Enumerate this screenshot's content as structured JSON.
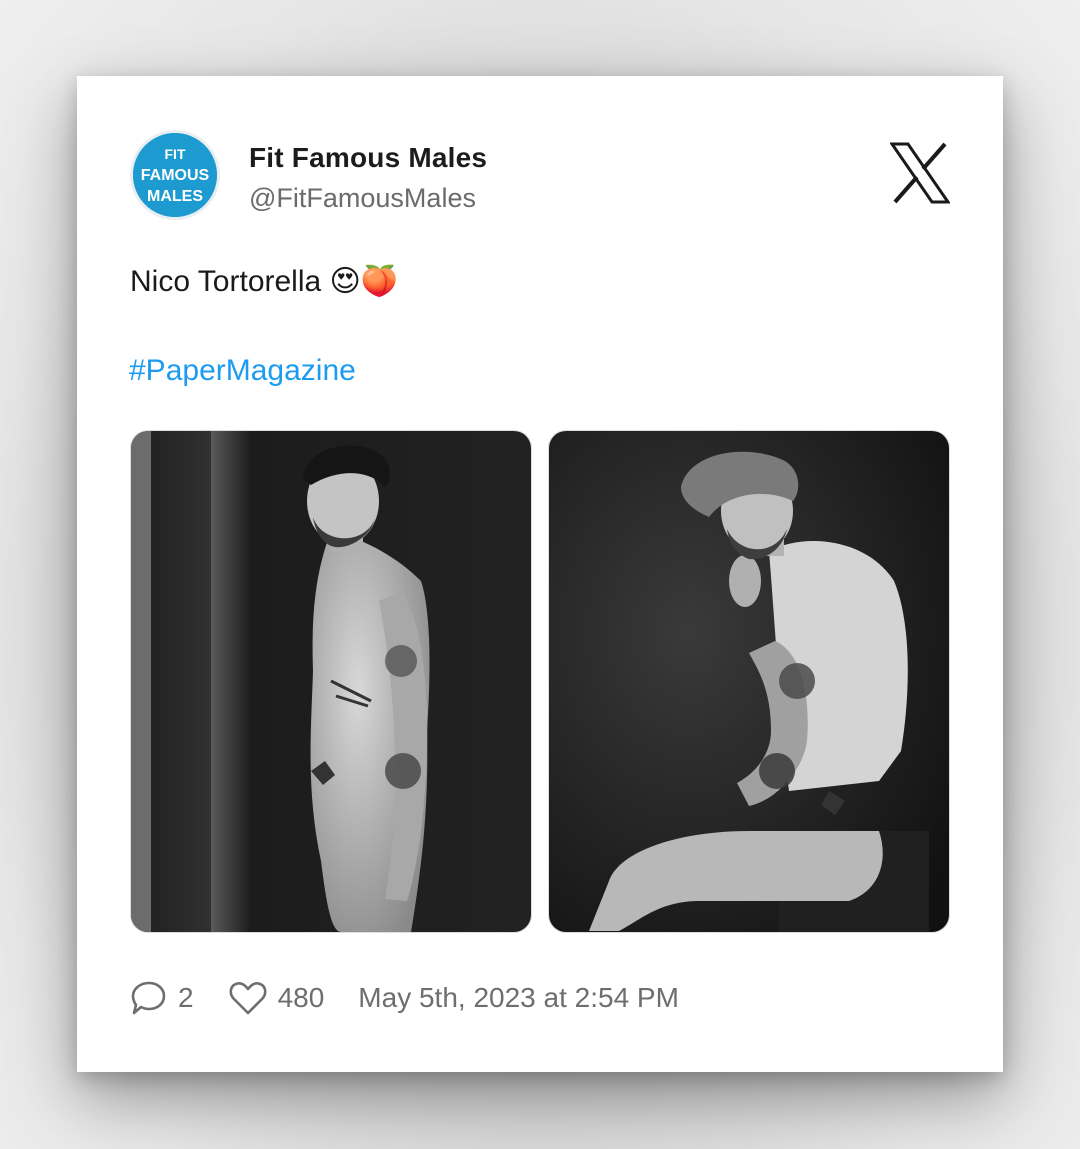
{
  "account": {
    "display_name": "Fit Famous Males",
    "handle": "@FitFamousMales",
    "avatar_text": [
      "FIT",
      "FAMOUS",
      "MALES"
    ],
    "avatar_color": "#1d9bd1"
  },
  "platform_icon": "x-logo-icon",
  "tweet": {
    "text": "Nico Tortorella",
    "emojis": "😍🍑",
    "hashtag": "#PaperMagazine"
  },
  "media": [
    {
      "icon": "photo-standing-figure"
    },
    {
      "icon": "photo-seated-figure-beanie"
    }
  ],
  "stats": {
    "replies": "2",
    "likes": "480",
    "timestamp": "May 5th, 2023 at 2:54 PM"
  },
  "colors": {
    "link": "#1d9bf0",
    "muted": "#6e6e6e",
    "card_bg": "#ffffff"
  }
}
